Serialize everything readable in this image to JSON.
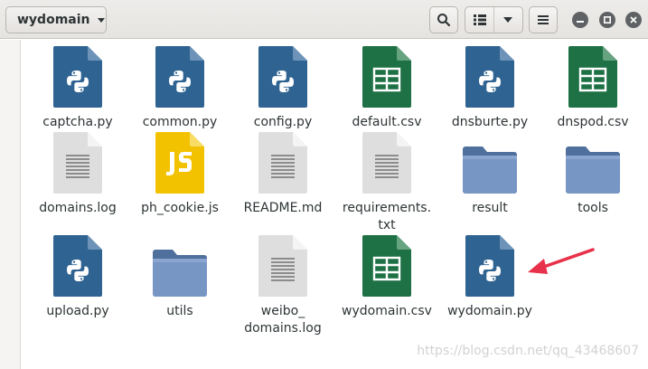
{
  "window": {
    "folder_name": "wydomain"
  },
  "files": [
    {
      "name": "captcha.py",
      "type": "python"
    },
    {
      "name": "common.py",
      "type": "python"
    },
    {
      "name": "config.py",
      "type": "python"
    },
    {
      "name": "default.csv",
      "type": "spreadsheet"
    },
    {
      "name": "dnsburte.py",
      "type": "python"
    },
    {
      "name": "dnspod.csv",
      "type": "spreadsheet"
    },
    {
      "name": "domains.log",
      "type": "text"
    },
    {
      "name": "ph_cookie.js",
      "type": "javascript"
    },
    {
      "name": "README.md",
      "type": "text"
    },
    {
      "name": "requirements.\ntxt",
      "type": "text"
    },
    {
      "name": "result",
      "type": "folder"
    },
    {
      "name": "tools",
      "type": "folder"
    },
    {
      "name": "upload.py",
      "type": "python"
    },
    {
      "name": "utils",
      "type": "folder"
    },
    {
      "name": "weibo_\ndomains.log",
      "type": "text"
    },
    {
      "name": "wydomain.csv",
      "type": "spreadsheet"
    },
    {
      "name": "wydomain.py",
      "type": "python"
    }
  ],
  "annotation": {
    "arrow_color": "#e8314a",
    "points_to": "wydomain.py"
  },
  "watermark": "https://blog.csdn.net/qq_43468607",
  "colors": {
    "python": "#2f6392",
    "spreadsheet": "#1e7145",
    "javascript": "#f2c200",
    "folder": "#7896c4",
    "text": "#dedede"
  }
}
